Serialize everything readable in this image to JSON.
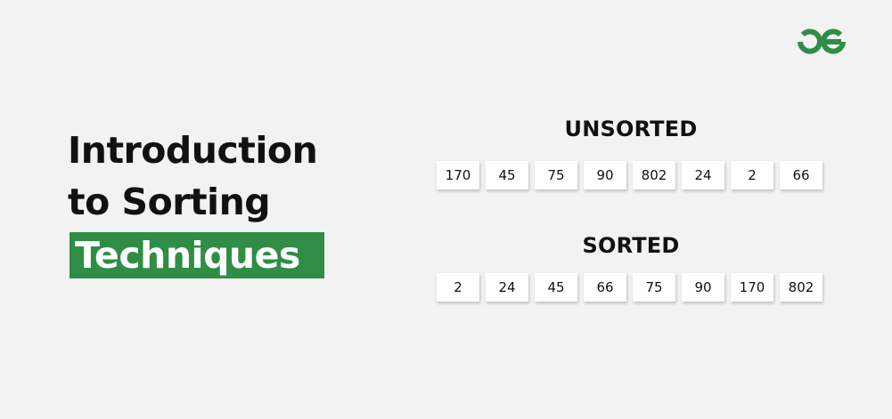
{
  "title": {
    "line1": "Introduction",
    "line2": "to Sorting",
    "line3": "Techniques"
  },
  "unsorted": {
    "heading": "UNSORTED",
    "values": [
      "170",
      "45",
      "75",
      "90",
      "802",
      "24",
      "2",
      "66"
    ]
  },
  "sorted": {
    "heading": "SORTED",
    "values": [
      "2",
      "24",
      "45",
      "66",
      "75",
      "90",
      "170",
      "802"
    ]
  },
  "logo": {
    "icon": "gfg-logo-icon",
    "color": "#2f8d46"
  },
  "colors": {
    "accent": "#2f8d46",
    "background": "#f2f2f2",
    "cell": "#ffffff",
    "text": "#111111"
  }
}
